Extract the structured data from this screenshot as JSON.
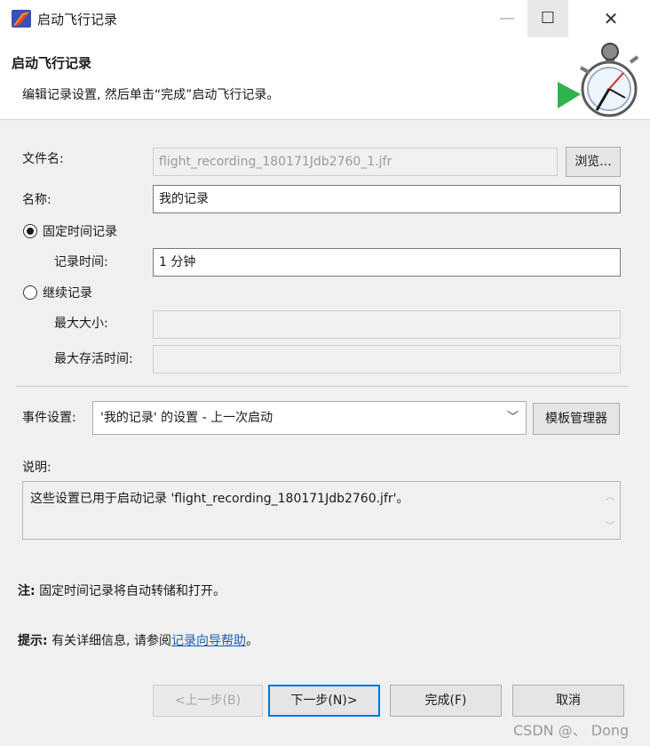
{
  "window": {
    "title": "启动飞行记录",
    "min_glyph": "—",
    "max_glyph": "☐",
    "close_glyph": "✕"
  },
  "header": {
    "title": "启动飞行记录",
    "description": "编辑记录设置, 然后单击“完成”启动飞行记录。",
    "icon": "stopwatch-wizard-icon"
  },
  "form": {
    "filename_label": "文件名:",
    "filename_value": "flight_recording_180171Jdb2760_1.jfr",
    "browse_label": "浏览...",
    "name_label": "名称:",
    "name_value": "我的记录",
    "fixed_radio_label": "固定时间记录",
    "fixed_radio_checked": true,
    "duration_label": "记录时间:",
    "duration_value": "1 分钟",
    "continuous_radio_label": "继续记录",
    "continuous_radio_checked": false,
    "max_size_label": "最大大小:",
    "max_size_value": "",
    "max_age_label": "最大存活时间:",
    "max_age_value": ""
  },
  "events": {
    "label": "事件设置:",
    "selected": "'我的记录' 的设置 - 上一次启动",
    "template_manager_label": "模板管理器"
  },
  "description": {
    "label": "说明:",
    "text": "这些设置已用于启动记录 'flight_recording_180171Jdb2760.jfr'。"
  },
  "notes": {
    "note_prefix": "注:",
    "note_text": "固定时间记录将自动转储和打开。",
    "tip_prefix": "提示:",
    "tip_text": "有关详细信息, 请参阅",
    "tip_link": "记录向导帮助",
    "tip_end": "。"
  },
  "footer": {
    "back_label": "<上一步(B)",
    "next_label": "下一步(N)>",
    "finish_label": "完成(F)",
    "cancel_label": "取消"
  },
  "watermark": "CSDN @、 Dong",
  "colors": {
    "accent": "#0078d7",
    "link": "#1a5fb4"
  }
}
